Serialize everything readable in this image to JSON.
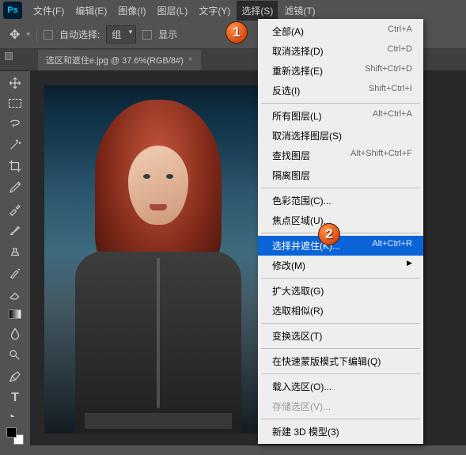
{
  "app": {
    "logo": "Ps"
  },
  "menubar": [
    {
      "label": "文件(F)"
    },
    {
      "label": "编辑(E)"
    },
    {
      "label": "图像(I)"
    },
    {
      "label": "图层(L)"
    },
    {
      "label": "文字(Y)"
    },
    {
      "label": "选择(S)",
      "active": true
    },
    {
      "label": "滤镜(T)"
    }
  ],
  "toolbar": {
    "auto_select_label": "自动选择:",
    "group_value": "组",
    "show_label": "显示"
  },
  "tab": {
    "title": "选区和遮住e.jpg @ 37.6%(RGB/8#)",
    "close": "×"
  },
  "select_menu": {
    "groups": [
      [
        {
          "label": "全部(A)",
          "shortcut": "Ctrl+A"
        },
        {
          "label": "取消选择(D)",
          "shortcut": "Ctrl+D"
        },
        {
          "label": "重新选择(E)",
          "shortcut": "Shift+Ctrl+D"
        },
        {
          "label": "反选(I)",
          "shortcut": "Shift+Ctrl+I"
        }
      ],
      [
        {
          "label": "所有图层(L)",
          "shortcut": "Alt+Ctrl+A"
        },
        {
          "label": "取消选择图层(S)",
          "shortcut": ""
        },
        {
          "label": "查找图层",
          "shortcut": "Alt+Shift+Ctrl+F"
        },
        {
          "label": "隔离图层",
          "shortcut": ""
        }
      ],
      [
        {
          "label": "色彩范围(C)...",
          "shortcut": ""
        },
        {
          "label": "焦点区域(U)...",
          "shortcut": ""
        }
      ],
      [
        {
          "label": "选择并遮住(K)...",
          "shortcut": "Alt+Ctrl+R",
          "highlight": true
        },
        {
          "label": "修改(M)",
          "shortcut": "",
          "submenu": true
        }
      ],
      [
        {
          "label": "扩大选取(G)",
          "shortcut": ""
        },
        {
          "label": "选取相似(R)",
          "shortcut": ""
        }
      ],
      [
        {
          "label": "变换选区(T)",
          "shortcut": ""
        }
      ],
      [
        {
          "label": "在快速蒙版模式下编辑(Q)",
          "shortcut": ""
        }
      ],
      [
        {
          "label": "载入选区(O)...",
          "shortcut": ""
        },
        {
          "label": "存储选区(V)...",
          "shortcut": "",
          "disabled": true
        }
      ],
      [
        {
          "label": "新建 3D 模型(3)",
          "shortcut": ""
        }
      ]
    ]
  },
  "markers": {
    "m1": "1",
    "m2": "2"
  },
  "tools": [
    "move",
    "marquee",
    "lasso",
    "wand",
    "crop",
    "eyedropper",
    "heal",
    "brush",
    "stamp",
    "history",
    "eraser",
    "gradient",
    "blur",
    "dodge",
    "pen",
    "type",
    "path",
    "shape"
  ]
}
